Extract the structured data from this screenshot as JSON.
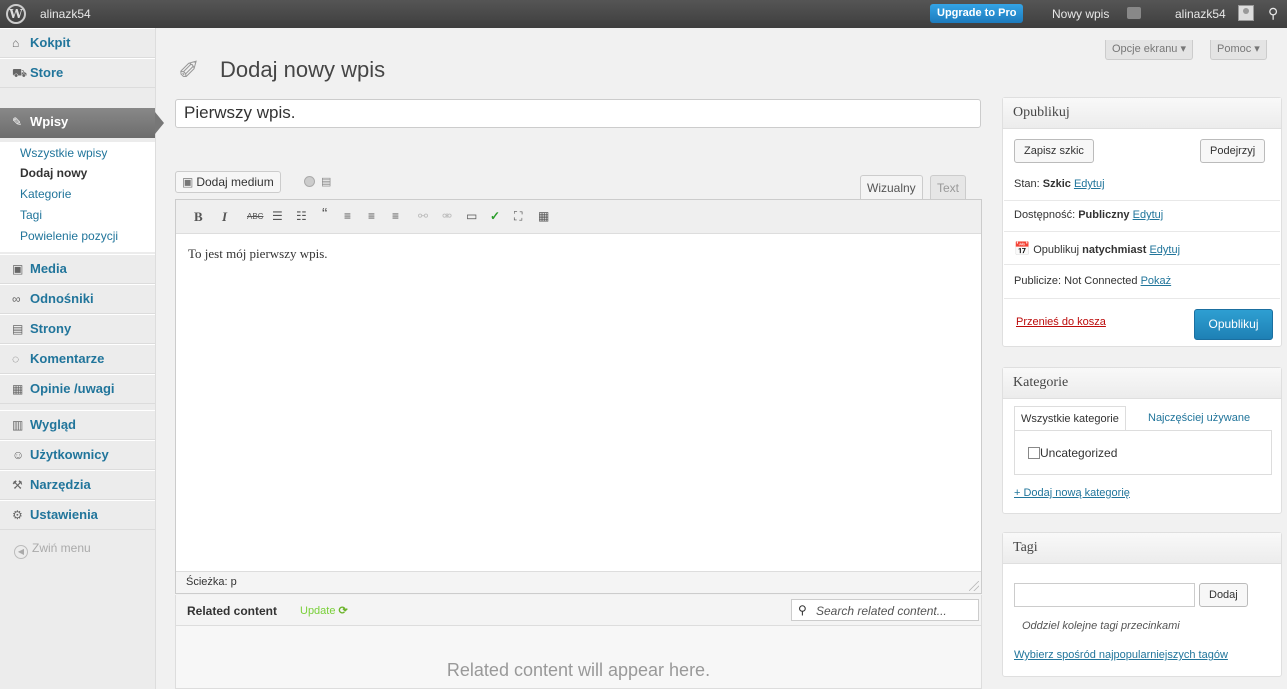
{
  "adminbar": {
    "logo": "W",
    "site_name": "alinazk54",
    "upgrade_label": "Upgrade to Pro",
    "new_post_label": "Nowy wpis",
    "user_name": "alinazk54",
    "icons": [
      "wordpress-logo-icon",
      "comment-bubble-icon",
      "avatar-icon",
      "search-icon"
    ]
  },
  "sidebar": {
    "items": [
      {
        "icon": "⌂",
        "icon_name": "home-icon",
        "label": "Kokpit"
      },
      {
        "icon": "⛟",
        "icon_name": "cart-icon",
        "label": "Store"
      },
      {
        "icon": "✎",
        "icon_name": "pin-icon",
        "label": "Wpisy"
      },
      {
        "icon": "▣",
        "icon_name": "media-icon",
        "label": "Media"
      },
      {
        "icon": "∞",
        "icon_name": "link-icon",
        "label": "Odnośniki"
      },
      {
        "icon": "▤",
        "icon_name": "pages-icon",
        "label": "Strony"
      },
      {
        "icon": "◌",
        "icon_name": "comments-icon",
        "label": "Komentarze"
      },
      {
        "icon": "▦",
        "icon_name": "feedback-icon",
        "label": "Opinie /uwagi"
      },
      {
        "icon": "▥",
        "icon_name": "appearance-icon",
        "label": "Wygląd"
      },
      {
        "icon": "☺",
        "icon_name": "users-icon",
        "label": "Użytkownicy"
      },
      {
        "icon": "⚒",
        "icon_name": "tools-icon",
        "label": "Narzędzia"
      },
      {
        "icon": "⚙",
        "icon_name": "settings-icon",
        "label": "Ustawienia"
      }
    ],
    "submenu": [
      "Wszystkie wpisy",
      "Dodaj nowy",
      "Kategorie",
      "Tagi",
      "Powielenie pozycji"
    ],
    "collapse_label": "Zwiń menu"
  },
  "screen_options": {
    "label": "Opcje ekranu ▾",
    "help": "Pomoc ▾"
  },
  "page": {
    "title": "Dodaj nowy wpis",
    "post_title_value": "Pierwszy wpis."
  },
  "editor": {
    "add_media_label": "Dodaj medium",
    "tab_visual": "Wizualny",
    "tab_text": "Text",
    "toolbar": [
      "B",
      "I",
      "ABC",
      "☰",
      "☷",
      "“",
      "≡",
      "≡",
      "≡",
      "⚯",
      "⚮",
      "▭",
      "✓",
      "⛶",
      "▦"
    ],
    "content": "To jest mój pierwszy wpis.",
    "path_label": "Ścieżka: p"
  },
  "related": {
    "title": "Related content",
    "update_label": "Update",
    "search_placeholder": "Search related content...",
    "empty_message": "Related content will appear here."
  },
  "publish": {
    "title": "Opublikuj",
    "save_draft": "Zapisz szkic",
    "preview": "Podejrzyj",
    "status_label": "Stan: ",
    "status_value": "Szkic",
    "visibility_label": "Dostępność: ",
    "visibility_value": "Publiczny",
    "publish_label": "Opublikuj ",
    "publish_value": "natychmiast",
    "edit": "Edytuj",
    "publicize": "Publicize: Not Connected ",
    "show": "Pokaż",
    "trash": "Przenieś do kosza",
    "publish_button": "Opublikuj"
  },
  "categories": {
    "title": "Kategorie",
    "tab_all": "Wszystkie kategorie",
    "tab_popular": "Najczęściej używane",
    "items": [
      "Uncategorized"
    ],
    "add_link": "+ Dodaj nową kategorię"
  },
  "tags": {
    "title": "Tagi",
    "add_button": "Dodaj",
    "hint": "Oddziel kolejne tagi przecinkami",
    "choose_link": "Wybierz spośród najpopularniejszych tagów"
  }
}
